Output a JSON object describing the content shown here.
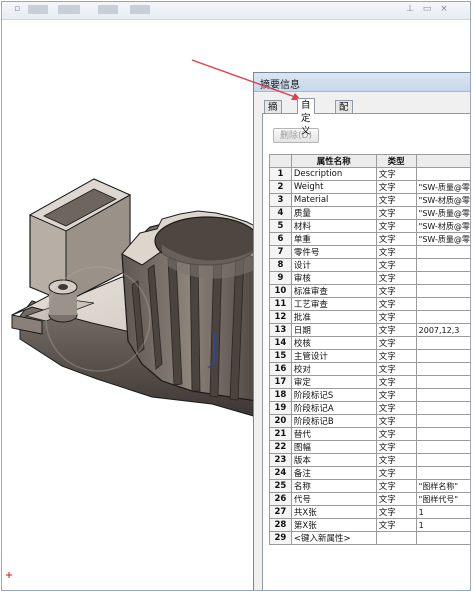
{
  "dialog": {
    "title": "摘要信息",
    "tabs": [
      {
        "label": "摘要"
      },
      {
        "label": "自定义"
      },
      {
        "label": "配置特定"
      }
    ],
    "delete_button": "删除(D)",
    "table": {
      "headers": [
        "",
        "属性名称",
        "类型",
        ""
      ],
      "rows": [
        {
          "num": "1",
          "name": "Description",
          "type": "文字",
          "value": ""
        },
        {
          "num": "2",
          "name": "Weight",
          "type": "文字",
          "value": "\"SW-质量@零"
        },
        {
          "num": "3",
          "name": "Material",
          "type": "文字",
          "value": "\"SW-材质@零"
        },
        {
          "num": "4",
          "name": "质量",
          "type": "文字",
          "value": "\"SW-质量@零"
        },
        {
          "num": "5",
          "name": "材料",
          "type": "文字",
          "value": "\"SW-材质@零"
        },
        {
          "num": "6",
          "name": "单重",
          "type": "文字",
          "value": "\"SW-质量@零"
        },
        {
          "num": "7",
          "name": "零件号",
          "type": "文字",
          "value": ""
        },
        {
          "num": "8",
          "name": "设计",
          "type": "文字",
          "value": ""
        },
        {
          "num": "9",
          "name": "审核",
          "type": "文字",
          "value": ""
        },
        {
          "num": "10",
          "name": "标准审查",
          "type": "文字",
          "value": ""
        },
        {
          "num": "11",
          "name": "工艺审查",
          "type": "文字",
          "value": ""
        },
        {
          "num": "12",
          "name": "批准",
          "type": "文字",
          "value": ""
        },
        {
          "num": "13",
          "name": "日期",
          "type": "文字",
          "value": "2007,12,3"
        },
        {
          "num": "14",
          "name": "校核",
          "type": "文字",
          "value": ""
        },
        {
          "num": "15",
          "name": "主管设计",
          "type": "文字",
          "value": ""
        },
        {
          "num": "16",
          "name": "校对",
          "type": "文字",
          "value": ""
        },
        {
          "num": "17",
          "name": "审定",
          "type": "文字",
          "value": ""
        },
        {
          "num": "18",
          "name": "阶段标记S",
          "type": "文字",
          "value": ""
        },
        {
          "num": "19",
          "name": "阶段标记A",
          "type": "文字",
          "value": ""
        },
        {
          "num": "20",
          "name": "阶段标记B",
          "type": "文字",
          "value": ""
        },
        {
          "num": "21",
          "name": "替代",
          "type": "文字",
          "value": ""
        },
        {
          "num": "22",
          "name": "图幅",
          "type": "文字",
          "value": ""
        },
        {
          "num": "23",
          "name": "版本",
          "type": "文字",
          "value": ""
        },
        {
          "num": "24",
          "name": "备注",
          "type": "文字",
          "value": ""
        },
        {
          "num": "25",
          "name": "名称",
          "type": "文字",
          "value": "\"图样名称\""
        },
        {
          "num": "26",
          "name": "代号",
          "type": "文字",
          "value": "\"图样代号\""
        },
        {
          "num": "27",
          "name": "共X张",
          "type": "文字",
          "value": "1"
        },
        {
          "num": "28",
          "name": "第X张",
          "type": "文字",
          "value": "1"
        },
        {
          "num": "29",
          "name": "<键入新属性>",
          "type": "",
          "value": ""
        }
      ]
    }
  },
  "colors": {
    "arrow": "#e0404a",
    "part_light": "#d8d2c9",
    "part_mid": "#a89e94",
    "part_dark": "#5a514b",
    "part_edge": "#1b1b1b"
  }
}
